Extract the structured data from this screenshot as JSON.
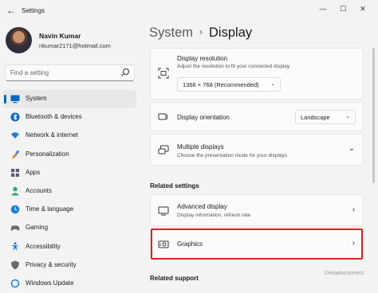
{
  "window": {
    "app_title": "Settings",
    "controls": [
      "—",
      "☐",
      "✕"
    ]
  },
  "profile": {
    "name": "Navin Kumar",
    "email": "nkumar2171@hotmail.com"
  },
  "search": {
    "placeholder": "Find a setting"
  },
  "sidebar": {
    "items": [
      {
        "label": "System",
        "icon": "system-icon",
        "selected": true,
        "color": "#0067c0"
      },
      {
        "label": "Bluetooth & devices",
        "icon": "bluetooth-icon",
        "color": "#0067c0"
      },
      {
        "label": "Network & internet",
        "icon": "wifi-icon",
        "color": "#1f7fd8"
      },
      {
        "label": "Personalization",
        "icon": "brush-icon",
        "color": "#d97b2a"
      },
      {
        "label": "Apps",
        "icon": "apps-icon",
        "color": "#5b5b70"
      },
      {
        "label": "Accounts",
        "icon": "person-icon",
        "color": "#2fa56f"
      },
      {
        "label": "Time & language",
        "icon": "globe-clock-icon",
        "color": "#1f7fd8"
      },
      {
        "label": "Gaming",
        "icon": "gamepad-icon",
        "color": "#6b6b6b"
      },
      {
        "label": "Accessibility",
        "icon": "accessibility-icon",
        "color": "#1f7fd8"
      },
      {
        "label": "Privacy & security",
        "icon": "shield-icon",
        "color": "#6b6b6b"
      },
      {
        "label": "Windows Update",
        "icon": "update-icon",
        "color": "#1f7fd8"
      }
    ]
  },
  "breadcrumb": {
    "parent": "System",
    "separator": "›",
    "current": "Display"
  },
  "cards": {
    "resolution": {
      "title": "Display resolution",
      "subtitle": "Adjust the resolution to fit your connected display",
      "value": "1366 × 768 (Recommended)"
    },
    "orientation": {
      "title": "Display orientation",
      "value": "Landscape"
    },
    "multiple": {
      "title": "Multiple displays",
      "subtitle": "Choose the presentation mode for your displays"
    }
  },
  "related_settings": {
    "heading": "Related settings",
    "advanced": {
      "title": "Advanced display",
      "subtitle": "Display information, refresh rate"
    },
    "graphics": {
      "title": "Graphics"
    }
  },
  "related_support": {
    "heading": "Related support"
  },
  "watermark": "©Howtoconnect",
  "colors": {
    "accent": "#0067c0",
    "highlight": "#e02020",
    "background": "#f3f3f3"
  }
}
